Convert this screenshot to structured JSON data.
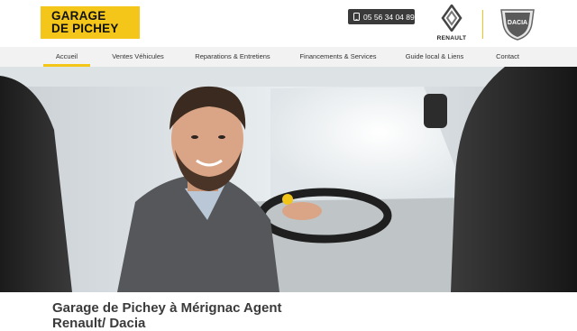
{
  "header": {
    "logo_line1": "GARAGE",
    "logo_line2": "DE PICHEY",
    "phone_icon": "phone-icon",
    "phone_number": "05 56 34 04 89",
    "brand1": "RENAULT",
    "brand2": "DACIA",
    "accent_color": "#f4c61a"
  },
  "nav": {
    "items": [
      {
        "label": "Accueil",
        "active": true
      },
      {
        "label": "Ventes Véhicules"
      },
      {
        "label": "Reparations & Entretiens"
      },
      {
        "label": "Financements & Services"
      },
      {
        "label": "Guide local & Liens"
      },
      {
        "label": "Contact"
      }
    ]
  },
  "hero": {
    "image": "smiling-man-driving-car-photo"
  },
  "main": {
    "headline": "Garage de Pichey à Mérignac Agent Renault/ Dacia"
  }
}
